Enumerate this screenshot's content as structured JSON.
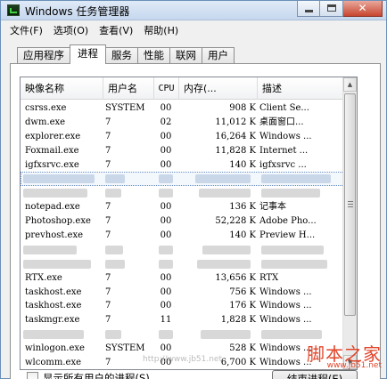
{
  "window": {
    "title": "Windows 任务管理器",
    "close_glyph": "✕"
  },
  "menu": [
    "文件(F)",
    "选项(O)",
    "查看(V)",
    "帮助(H)"
  ],
  "tabs": [
    "应用程序",
    "进程",
    "服务",
    "性能",
    "联网",
    "用户"
  ],
  "active_tab": "进程",
  "columns": {
    "image": "映像名称",
    "user": "用户名",
    "cpu": "CPU",
    "mem": "内存(...",
    "desc": "描述"
  },
  "processes": [
    {
      "image": "csrss.exe",
      "user": "SYSTEM",
      "cpu": "00",
      "mem": "908 K",
      "desc": "Client Se..."
    },
    {
      "image": "dwm.exe",
      "user": "7",
      "cpu": "02",
      "mem": "11,012 K",
      "desc": "桌面窗口..."
    },
    {
      "image": "explorer.exe",
      "user": "7",
      "cpu": "00",
      "mem": "16,264 K",
      "desc": "Windows ..."
    },
    {
      "image": "Foxmail.exe",
      "user": "7",
      "cpu": "00",
      "mem": "11,828 K",
      "desc": "Internet ..."
    },
    {
      "image": "igfxsrvc.exe",
      "user": "7",
      "cpu": "00",
      "mem": "140 K",
      "desc": "igfxsrvc ..."
    },
    {
      "image": "",
      "user": "",
      "cpu": "",
      "mem": "",
      "desc": "",
      "blurred": true,
      "selected": true
    },
    {
      "image": "",
      "user": "",
      "cpu": "",
      "mem": "",
      "desc": "",
      "blurred": true
    },
    {
      "image": "notepad.exe",
      "user": "7",
      "cpu": "00",
      "mem": "136 K",
      "desc": "记事本"
    },
    {
      "image": "Photoshop.exe",
      "user": "7",
      "cpu": "00",
      "mem": "52,228 K",
      "desc": "Adobe Pho..."
    },
    {
      "image": "prevhost.exe",
      "user": "7",
      "cpu": "00",
      "mem": "140 K",
      "desc": "Preview H..."
    },
    {
      "image": "",
      "user": "",
      "cpu": "",
      "mem": "",
      "desc": "",
      "blurred": true
    },
    {
      "image": "",
      "user": "",
      "cpu": "",
      "mem": "",
      "desc": "",
      "blurred": true
    },
    {
      "image": "RTX.exe",
      "user": "7",
      "cpu": "00",
      "mem": "13,656 K",
      "desc": "RTX"
    },
    {
      "image": "taskhost.exe",
      "user": "7",
      "cpu": "00",
      "mem": "756 K",
      "desc": "Windows ..."
    },
    {
      "image": "taskhost.exe",
      "user": "7",
      "cpu": "00",
      "mem": "176 K",
      "desc": "Windows ..."
    },
    {
      "image": "taskmgr.exe",
      "user": "7",
      "cpu": "11",
      "mem": "1,828 K",
      "desc": "Windows ..."
    },
    {
      "image": "",
      "user": "",
      "cpu": "",
      "mem": "",
      "desc": "",
      "blurred": true
    },
    {
      "image": "winlogon.exe",
      "user": "SYSTEM",
      "cpu": "00",
      "mem": "528 K",
      "desc": "Windows ..."
    },
    {
      "image": "wlcomm.exe",
      "user": "7",
      "cpu": "00",
      "mem": "6,700 K",
      "desc": "Windows ..."
    }
  ],
  "footer": {
    "show_all_label": "显示所有用户的进程(S)",
    "show_all_checked": false,
    "end_process_label": "结束进程(E)"
  },
  "watermark": {
    "main": "脚本之家",
    "sub": "www.jb51.net",
    "faint": "http://www.jb51.net"
  },
  "colors": {
    "accent": "#3a6ea5",
    "watermark": "#e0452a"
  }
}
